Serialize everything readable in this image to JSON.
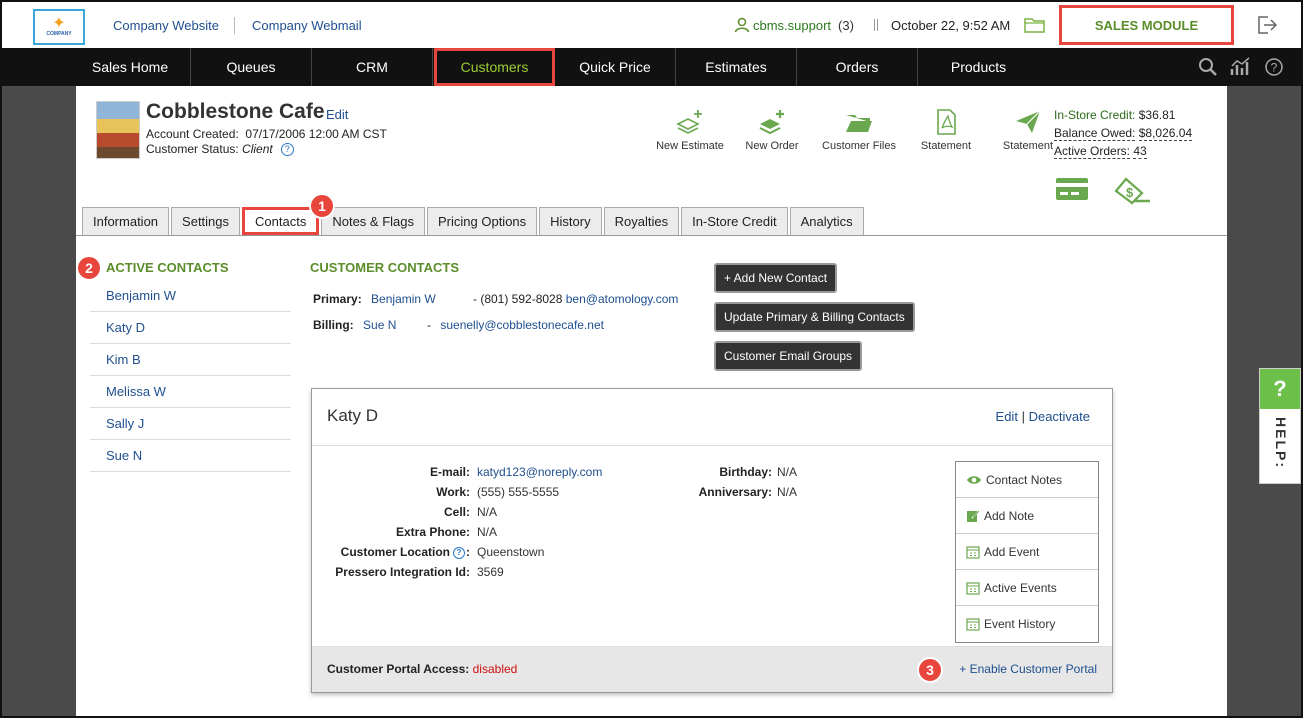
{
  "topbar": {
    "company_website": "Company Website",
    "company_webmail": "Company Webmail",
    "user": "cbms.support",
    "user_count": "(3)",
    "datetime": "October 22, 9:52 AM",
    "module": "SALES MODULE"
  },
  "nav": {
    "items": [
      "Sales Home",
      "Queues",
      "CRM",
      "Customers",
      "Quick Price",
      "Estimates",
      "Orders",
      "Products"
    ],
    "active": "Customers"
  },
  "customer": {
    "name": "Cobblestone Cafe",
    "edit": "Edit",
    "account_created_label": "Account Created:",
    "account_created": "07/17/2006 12:00 AM CST",
    "status_label": "Customer Status:",
    "status": "Client"
  },
  "actions": [
    "New Estimate",
    "New Order",
    "Customer Files",
    "Statement",
    "Statement"
  ],
  "credit": {
    "instore_label": "In-Store Credit:",
    "instore": "$36.81",
    "owed_label": "Balance Owed:",
    "owed": "$8,026.04",
    "orders_label": "Active Orders:",
    "orders": "43"
  },
  "tabs": [
    "Information",
    "Settings",
    "Contacts",
    "Notes & Flags",
    "Pricing Options",
    "History",
    "Royalties",
    "In-Store Credit",
    "Analytics"
  ],
  "active_contacts": {
    "title": "ACTIVE CONTACTS",
    "items": [
      "Benjamin W",
      "Katy D",
      "Kim B",
      "Melissa W",
      "Sally J",
      "Sue N"
    ]
  },
  "customer_contacts": {
    "title": "CUSTOMER CONTACTS",
    "primary_label": "Primary:",
    "primary_name": "Benjamin W",
    "primary_phone": "- (801) 592-8028",
    "primary_email": "ben@atomology.com",
    "billing_label": "Billing:",
    "billing_name": "Sue N",
    "billing_sep": "-",
    "billing_email": "suenelly@cobblestonecafe.net"
  },
  "buttons": {
    "add_contact": "+ Add New Contact",
    "update_primary": "Update Primary & Billing Contacts",
    "email_groups": "Customer Email Groups"
  },
  "contact_card": {
    "name": "Katy D",
    "edit": "Edit",
    "sep": "|",
    "deactivate": "Deactivate",
    "labels": [
      "E-mail:",
      "Work:",
      "Cell:",
      "Extra Phone:",
      "Customer Location",
      "Pressero Integration Id:"
    ],
    "email": "katyd123@noreply.com",
    "work": "(555) 555-5555",
    "cell": "N/A",
    "extra_phone": "N/A",
    "location": "Queenstown",
    "pressero_id": "3569",
    "birthday_label": "Birthday:",
    "birthday": "N/A",
    "anniversary_label": "Anniversary:",
    "anniversary": "N/A",
    "notes_menu": [
      "Contact Notes",
      "Add Note",
      "Add Event",
      "Active Events",
      "Event History"
    ],
    "portal_label": "Customer Portal Access:",
    "portal_status": "disabled",
    "enable_portal": "+ Enable Customer Portal"
  },
  "badges": [
    "1",
    "2",
    "3"
  ],
  "help": {
    "q": "?",
    "text": "HELP:"
  },
  "colors": {
    "accent_green": "#5b8d2a",
    "highlight_red": "#e8453c",
    "nav_bg": "#111111",
    "link_blue": "#1f4f8f"
  }
}
